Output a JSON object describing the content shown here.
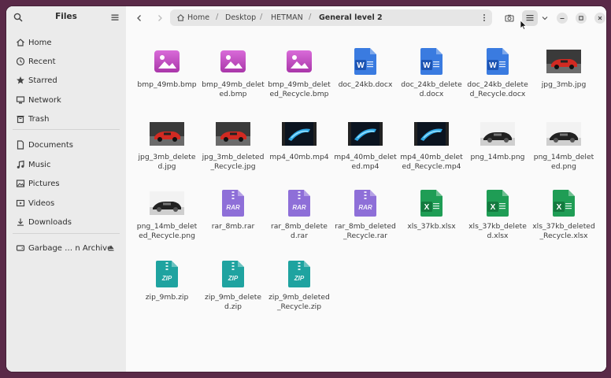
{
  "sidebar": {
    "title": "Files",
    "items": [
      {
        "label": "Home",
        "icon": "home-icon"
      },
      {
        "label": "Recent",
        "icon": "clock-icon"
      },
      {
        "label": "Starred",
        "icon": "star-icon"
      },
      {
        "label": "Network",
        "icon": "network-icon"
      },
      {
        "label": "Trash",
        "icon": "trash-icon"
      },
      {
        "label": "Documents",
        "icon": "document-icon"
      },
      {
        "label": "Music",
        "icon": "music-icon"
      },
      {
        "label": "Pictures",
        "icon": "pictures-icon"
      },
      {
        "label": "Videos",
        "icon": "video-icon"
      },
      {
        "label": "Downloads",
        "icon": "download-icon"
      },
      {
        "label": "Garbage … n Archive",
        "icon": "drive-icon"
      }
    ]
  },
  "path": {
    "home": "Home",
    "segments": [
      "Desktop",
      "HETMAN",
      "General level 2"
    ]
  },
  "files": [
    {
      "name": "bmp_49mb.bmp",
      "type": "bmp"
    },
    {
      "name": "bmp_49mb_deleted.bmp",
      "type": "bmp"
    },
    {
      "name": "bmp_49mb_deleted_Recycle.bmp",
      "type": "bmp"
    },
    {
      "name": "doc_24kb.docx",
      "type": "docx"
    },
    {
      "name": "doc_24kb_deleted.docx",
      "type": "docx"
    },
    {
      "name": "doc_24kb_deleted_Recycle.docx",
      "type": "docx"
    },
    {
      "name": "jpg_3mb.jpg",
      "type": "jpg"
    },
    {
      "name": "jpg_3mb_deleted.jpg",
      "type": "jpg"
    },
    {
      "name": "jpg_3mb_deleted_Recycle.jpg",
      "type": "jpg"
    },
    {
      "name": "mp4_40mb.mp4",
      "type": "mp4"
    },
    {
      "name": "mp4_40mb_deleted.mp4",
      "type": "mp4"
    },
    {
      "name": "mp4_40mb_deleted_Recycle.mp4",
      "type": "mp4"
    },
    {
      "name": "png_14mb.png",
      "type": "png"
    },
    {
      "name": "png_14mb_deleted.png",
      "type": "png"
    },
    {
      "name": "png_14mb_deleted_Recycle.png",
      "type": "png"
    },
    {
      "name": "rar_8mb.rar",
      "type": "rar"
    },
    {
      "name": "rar_8mb_deleted.rar",
      "type": "rar"
    },
    {
      "name": "rar_8mb_deleted_Recycle.rar",
      "type": "rar"
    },
    {
      "name": "xls_37kb.xlsx",
      "type": "xlsx"
    },
    {
      "name": "xls_37kb_deleted.xlsx",
      "type": "xlsx"
    },
    {
      "name": "xls_37kb_deleted_Recycle.xlsx",
      "type": "xlsx"
    },
    {
      "name": "zip_9mb.zip",
      "type": "zip"
    },
    {
      "name": "zip_9mb_deleted.zip",
      "type": "zip"
    },
    {
      "name": "zip_9mb_deleted_Recycle.zip",
      "type": "zip"
    }
  ],
  "icon_labels": {
    "docx": "W",
    "xlsx": "X",
    "rar": "RAR",
    "zip": "ZIP"
  },
  "colors": {
    "bmp": "#c44fc4",
    "docx": "#3a7be0",
    "xlsx": "#1f9d55",
    "rar": "#8e6fd8",
    "zip": "#1fa3a0"
  }
}
